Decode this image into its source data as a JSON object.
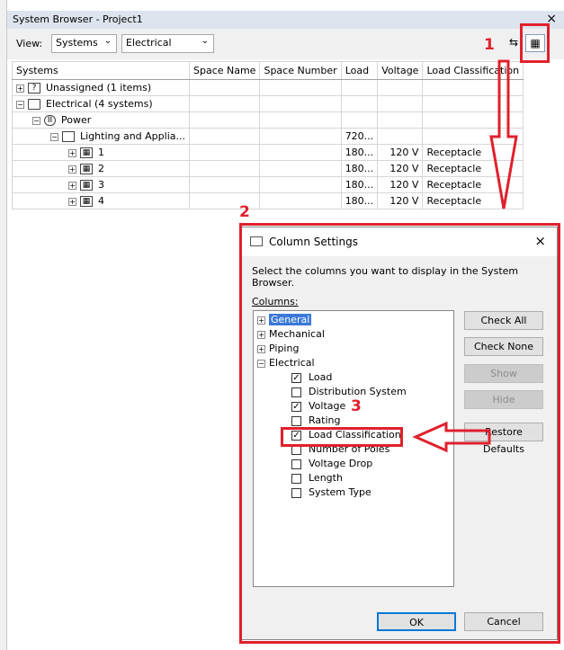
{
  "palette": {
    "title": "System Browser - Project1",
    "close": "×"
  },
  "toolbar": {
    "view_label": "View:",
    "view_value": "Systems",
    "discipline_value": "Electrical"
  },
  "grid": {
    "headers": [
      "Systems",
      "Space Name",
      "Space Number",
      "Load",
      "Voltage",
      "Load Classification"
    ],
    "rows": [
      {
        "expander": "+",
        "name": "Unassigned (1 items)",
        "load": "",
        "voltage": "",
        "classification": ""
      },
      {
        "expander": "−",
        "name": "Electrical (4 systems)",
        "load": "",
        "voltage": "",
        "classification": ""
      },
      {
        "expander": "−",
        "name": "Power",
        "load": "",
        "voltage": "",
        "classification": ""
      },
      {
        "expander": "−",
        "name": "Lighting and Applia...",
        "load": "720...",
        "voltage": "",
        "classification": ""
      },
      {
        "expander": "+",
        "name": "1",
        "load": "180...",
        "voltage": "120 V",
        "classification": "Receptacle"
      },
      {
        "expander": "+",
        "name": "2",
        "load": "180...",
        "voltage": "120 V",
        "classification": "Receptacle"
      },
      {
        "expander": "+",
        "name": "3",
        "load": "180...",
        "voltage": "120 V",
        "classification": "Receptacle"
      },
      {
        "expander": "+",
        "name": "4",
        "load": "180...",
        "voltage": "120 V",
        "classification": "Receptacle"
      }
    ]
  },
  "dialog": {
    "title": "Column Settings",
    "close": "×",
    "instruction": "Select the columns you want to display in the System Browser.",
    "columns_label": "Columns:",
    "categories": [
      "General",
      "Mechanical",
      "Piping",
      "Electrical"
    ],
    "electrical_items": [
      {
        "label": "Load",
        "checked": true
      },
      {
        "label": "Distribution System",
        "checked": false
      },
      {
        "label": "Voltage",
        "checked": true
      },
      {
        "label": "Rating",
        "checked": false
      },
      {
        "label": "Load Classification",
        "checked": true
      },
      {
        "label": "Number of Poles",
        "checked": false
      },
      {
        "label": "Voltage Drop",
        "checked": false
      },
      {
        "label": "Length",
        "checked": false
      },
      {
        "label": "System Type",
        "checked": false
      }
    ],
    "buttons": {
      "check_all": "Check All",
      "check_none": "Check None",
      "show": "Show",
      "hide": "Hide",
      "restore": "Restore Defaults",
      "ok": "OK",
      "cancel": "Cancel"
    }
  },
  "annotations": {
    "step1": "1",
    "step2": "2",
    "step3": "3",
    "color": "#e0202c"
  }
}
